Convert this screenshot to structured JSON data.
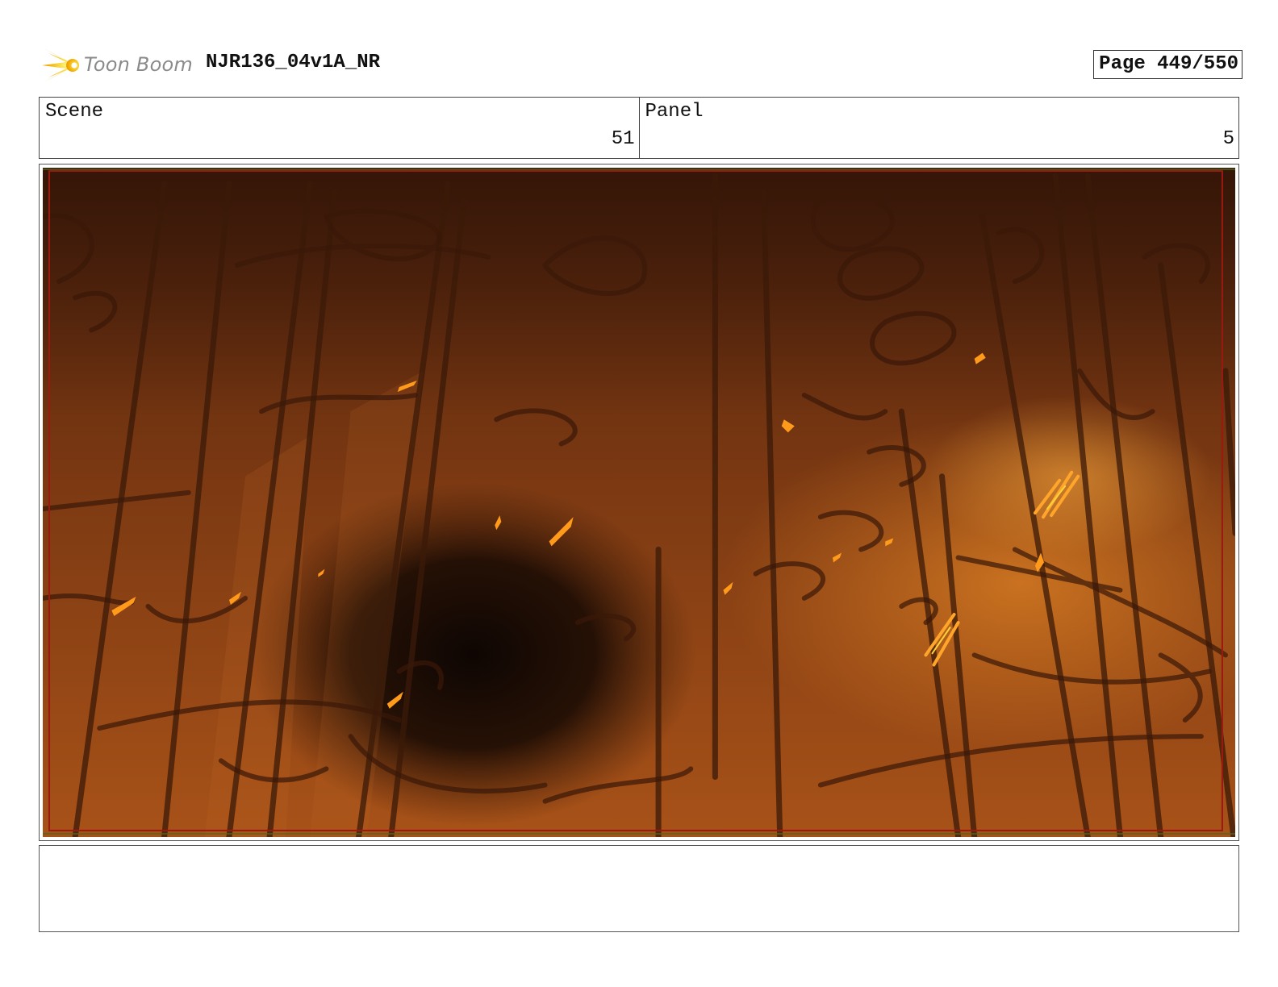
{
  "header": {
    "logo_text": "Toon Boom",
    "title": "NJR136_04v1A_NR",
    "page_label": "Page 449/550"
  },
  "scene": {
    "label": "Scene",
    "value": "51"
  },
  "panel": {
    "label": "Panel",
    "value": "5"
  },
  "notes": {
    "text": ""
  },
  "colors": {
    "logo_burst": "#f5c21a",
    "art_base": "#8a3f12",
    "art_dark": "#140a04",
    "ember": "#ff9a1a"
  }
}
